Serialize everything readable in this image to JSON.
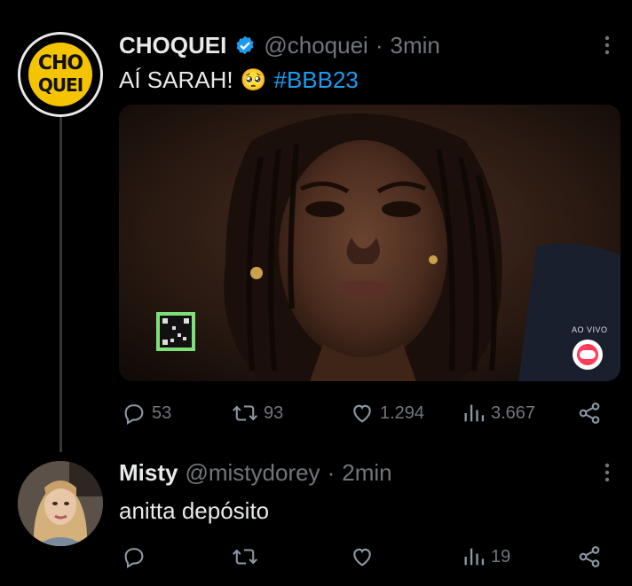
{
  "tweet": {
    "display_name": "CHOQUEI",
    "handle": "@choquei",
    "separator": "·",
    "time": "3min",
    "text_main": "AÍ SARAH!",
    "emoji": "🥺",
    "hashtag": "#BBB23",
    "avatar_text_top": "CHO",
    "avatar_text_bottom": "QUEI",
    "media_badge_live": "AO VIVO",
    "actions": {
      "replies": "53",
      "retweets": "93",
      "likes": "1.294",
      "views": "3.667"
    }
  },
  "reply": {
    "display_name": "Misty",
    "handle": "@mistydorey",
    "separator": "·",
    "time": "2min",
    "text": "anitta depósito",
    "actions": {
      "replies": "",
      "retweets": "",
      "likes": "",
      "views": "19"
    }
  },
  "colors": {
    "background": "#000000",
    "text": "#e7e9ea",
    "muted": "#71767b",
    "link": "#1d9bf0",
    "verified": "#1d9bf0",
    "avatar_yellow": "#f5c400"
  }
}
